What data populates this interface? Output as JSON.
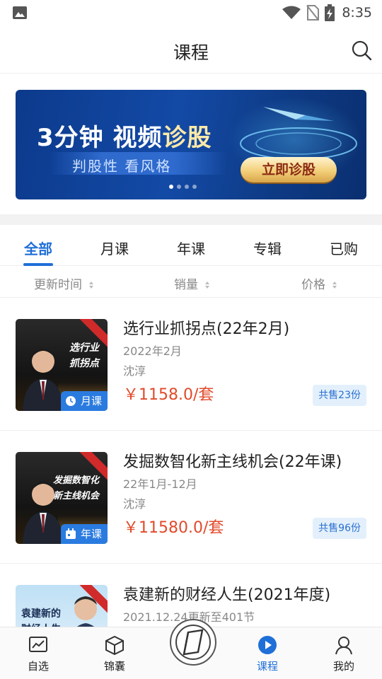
{
  "status_bar": {
    "time": "8:35"
  },
  "header": {
    "title": "课程"
  },
  "banner": {
    "headline_a": "3分钟 视频",
    "headline_b": "诊股",
    "subtitle": "判股性  看风格",
    "cta": "立即诊股",
    "page_count": 4,
    "active_page": 1
  },
  "tabs": [
    {
      "label": "全部",
      "active": true
    },
    {
      "label": "月课",
      "active": false
    },
    {
      "label": "年课",
      "active": false
    },
    {
      "label": "专辑",
      "active": false
    },
    {
      "label": "已购",
      "active": false
    }
  ],
  "sort_options": [
    "更新时间",
    "销量",
    "价格"
  ],
  "courses": [
    {
      "title": "选行业抓拐点(22年2月)",
      "period": "2022年2月",
      "author": "沈淳",
      "price": "￥1158.0/套",
      "sold": "共售23份",
      "tag": "月课",
      "thumb_text": [
        "选行业",
        "抓拐点"
      ]
    },
    {
      "title": "发掘数智化新主线机会(22年课)",
      "period": "22年1月-12月",
      "author": "沈淳",
      "price": "￥11580.0/套",
      "sold": "共售96份",
      "tag": "年课",
      "thumb_text": [
        "发掘数智化",
        "新主线机会"
      ]
    },
    {
      "title": "袁建新的财经人生(2021年度)",
      "period": "2021.12.24更新至401节",
      "thumb_text": [
        "袁建新的",
        "财经人生"
      ]
    }
  ],
  "bottom_nav": [
    {
      "label": "自选",
      "icon": "chart-icon",
      "active": false
    },
    {
      "label": "锦囊",
      "icon": "cube-icon",
      "active": false
    },
    {
      "label": "",
      "icon": "center-logo-icon",
      "active": false
    },
    {
      "label": "课程",
      "icon": "play-icon",
      "active": true
    },
    {
      "label": "我的",
      "icon": "user-icon",
      "active": false
    }
  ],
  "colors": {
    "accent": "#1f6fd8",
    "price": "#e24a2a",
    "tag": "#2a7be0"
  }
}
